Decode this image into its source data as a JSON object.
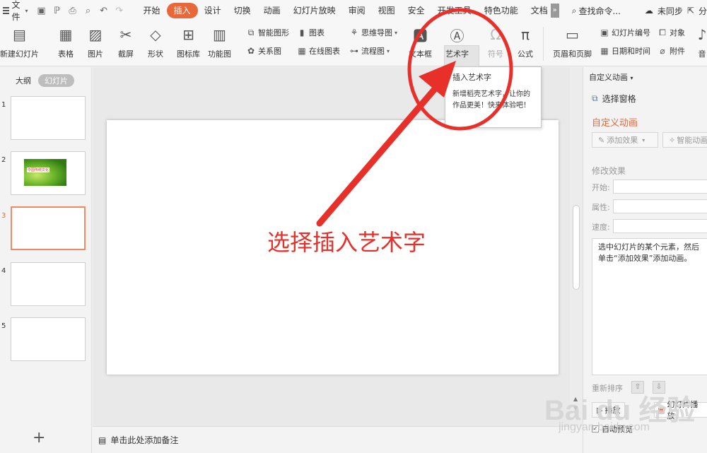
{
  "menubar": {
    "file_label": "文件",
    "tabs": [
      "开始",
      "插入",
      "设计",
      "切换",
      "动画",
      "幻灯片放映",
      "审阅",
      "视图",
      "安全",
      "开发工具",
      "特色功能",
      "文档"
    ],
    "active_tab": "插入",
    "more": "»",
    "search_label": "查找命令...",
    "sync_label": "未同步",
    "share_label": "分"
  },
  "ribbon": {
    "new_slide": "新建幻灯片",
    "table": "表格",
    "picture": "图片",
    "screenshot": "截屏",
    "shape": "形状",
    "icon_library": "图标库",
    "function_chart": "功能图",
    "smart_graphic": "智能图形",
    "chart": "图表",
    "relation": "关系图",
    "online_chart": "在线图表",
    "mindmap": "思维导图",
    "flowchart": "流程图",
    "textbox": "文本框",
    "wordart": "艺术字",
    "symbol": "符号",
    "formula": "公式",
    "header_footer": "页眉和页脚",
    "slide_number": "幻灯片编号",
    "datetime": "日期和时间",
    "object": "对象",
    "attachment": "附件",
    "audio": "音"
  },
  "tooltip": {
    "title": "插入艺术字",
    "body": "新增稻壳艺术字，让你的作品更美！快来体验吧！"
  },
  "left_panel": {
    "outline_tab": "大纲",
    "slides_tab": "幻灯片",
    "slide_numbers": [
      "1",
      "2",
      "3",
      "4",
      "5"
    ],
    "current_slide": "3",
    "thumb2_caption": "中国传统文化",
    "add": "+"
  },
  "canvas": {
    "annotation": "选择插入艺术字"
  },
  "notes": {
    "placeholder": "单击此处添加备注"
  },
  "right_panel": {
    "pane_title": "自定义动画",
    "select_pane": "选择窗格",
    "section_title": "自定义动画",
    "add_effect": "添加效果",
    "smart_anim": "智能动画",
    "modify_title": "修改效果",
    "start_label": "开始:",
    "property_label": "属性:",
    "speed_label": "速度:",
    "hint": "选中幻灯片的某个元素，然后单击“添加效果”添加动画。",
    "reorder": "重新排序",
    "play": "播放",
    "slideshow": "幻灯片播放",
    "autopreview": "自动预览"
  },
  "watermark": {
    "brand": "Bai du 经验",
    "url": "jingyan.baidu.com"
  },
  "colors": {
    "accent": "#e9683a",
    "annotation_red": "#e8302b"
  }
}
